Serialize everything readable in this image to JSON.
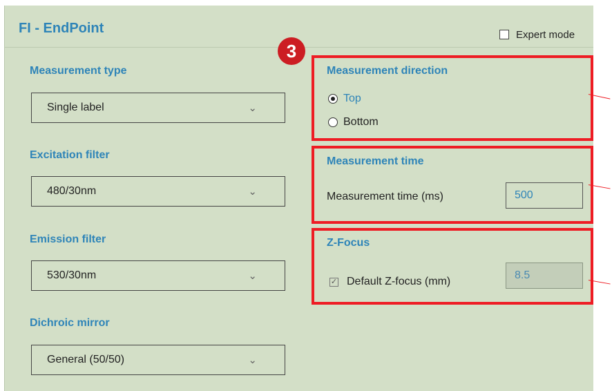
{
  "panel": {
    "title": "FI - EndPoint",
    "expert_mode_label": "Expert mode",
    "expert_mode_checked": false
  },
  "left_fields": [
    {
      "label": "Measurement type",
      "value": "Single label"
    },
    {
      "label": "Excitation filter",
      "value": "480/30nm"
    },
    {
      "label": "Emission filter",
      "value": "530/30nm"
    },
    {
      "label": "Dichroic mirror",
      "value": "General (50/50)"
    }
  ],
  "callout": {
    "number": "3",
    "highlight_color": "#ee1c24"
  },
  "direction": {
    "label": "Measurement direction",
    "options": [
      "Top",
      "Bottom"
    ],
    "selected": "Top"
  },
  "time": {
    "label": "Measurement time",
    "field_label": "Measurement time (ms)",
    "value": "500"
  },
  "zfocus": {
    "label": "Z-Focus",
    "checkbox_label": "Default Z-focus (mm)",
    "checked": true,
    "value": "8.5"
  },
  "colors": {
    "panel_bg": "#d3dfc7",
    "accent_blue": "#2e84b8",
    "badge_red": "#cc1d23"
  }
}
